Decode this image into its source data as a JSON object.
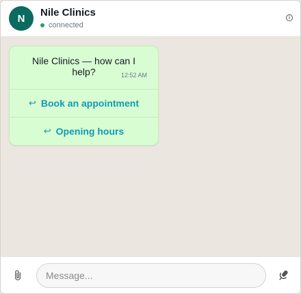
{
  "header": {
    "avatar_initial": "N",
    "title": "Nile Clinics",
    "status": "connected",
    "info_icon": "info-icon"
  },
  "chat": {
    "message": {
      "text": "Nile Clinics — how can I help?",
      "time": "12:52 AM"
    },
    "quick_replies": [
      {
        "label": "Book an appointment",
        "icon": "↩"
      },
      {
        "label": "Opening hours",
        "icon": "↩"
      }
    ]
  },
  "composer": {
    "placeholder": "Message...",
    "attach_icon": "paperclip-icon",
    "mic_icon": "microphone-icon"
  },
  "colors": {
    "avatar": "#0b6b5f",
    "bubble": "#d9fdd3",
    "quick_reply_text": "#0e9bb0",
    "status_dot": "#25a06a",
    "chat_background": "#ebe6df"
  }
}
